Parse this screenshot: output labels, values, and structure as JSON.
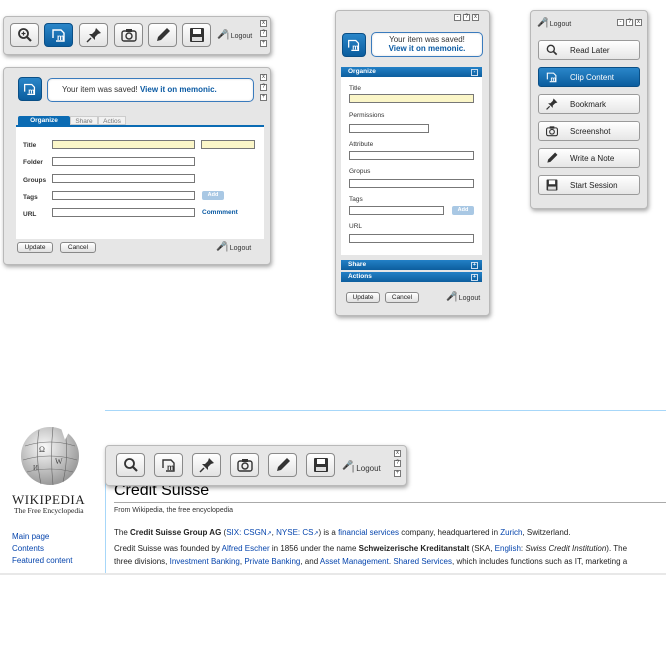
{
  "toolbar_top": {
    "buttons": [
      {
        "icon": "read-later-icon",
        "label": "Read Later"
      },
      {
        "icon": "clip-content-icon",
        "label": "Clip Content"
      },
      {
        "icon": "bookmark-icon",
        "label": "Bookmark"
      },
      {
        "icon": "screenshot-icon",
        "label": "Screenshot"
      },
      {
        "icon": "write-note-icon",
        "label": "Write a Note"
      },
      {
        "icon": "start-session-icon",
        "label": "Start Session"
      }
    ],
    "logout": "| Logout"
  },
  "saved_message": {
    "text": "Your item was saved!",
    "link": "View it on memonic."
  },
  "horizontal_form": {
    "tabs": [
      "Organize",
      "Share",
      "Actios"
    ],
    "fields": {
      "title": "Title",
      "folder": "Folder",
      "groups": "Groups",
      "tags": "Tags",
      "url": "URL"
    },
    "add_label": "Add",
    "comment_link": "Commment",
    "update_label": "Update",
    "cancel_label": "Cancel",
    "logout": "| Logout"
  },
  "vertical_form": {
    "organize_bar": "Organize",
    "fields": {
      "title": "Title",
      "permissions": "Permissions",
      "attribute": "Attribute",
      "groups": "Gropus",
      "tags": "Tags",
      "url": "URL"
    },
    "add_label": "Add",
    "share_bar": "Share",
    "actions_bar": "Actions",
    "update_label": "Update",
    "cancel_label": "Cancel",
    "logout": "| Logout"
  },
  "menu": {
    "logout": "| Logout",
    "items": [
      "Read Later",
      "Clip Content",
      "Bookmark",
      "Screenshot",
      "Write a Note",
      "Start Session"
    ]
  },
  "wikipedia": {
    "wordmark": "WIKIPEDIA",
    "tagline": "The Free Encyclopedia",
    "nav": [
      "Main page",
      "Contents",
      "Featured content"
    ],
    "title": "Credit Suisse",
    "from": "From Wikipedia, the free encyclopedia",
    "p1": {
      "a": "The ",
      "b": "Credit Suisse Group AG",
      "c": " (",
      "d": "SIX: CSGN",
      "e": ", ",
      "f": "NYSE: CS",
      "g": ") is a ",
      "h": "financial services",
      "i": " company, headquartered in ",
      "j": "Zurich",
      "k": ", Switzerland."
    },
    "p2": {
      "a": "Credit Suisse was founded by ",
      "b": "Alfred Escher",
      "c": " in 1856 under the name ",
      "d": "Schweizerische Kreditanstalt",
      "e": " (SKA, ",
      "f": "English",
      "g": ": ",
      "h": "Swiss Credit Institution",
      "i": "). The"
    },
    "p3": {
      "a": "three divisions, ",
      "b": "Investment Banking",
      "c": ", ",
      "d": "Private Banking",
      "e": ", and ",
      "f": "Asset Management",
      "g": ". ",
      "h": "Shared Services",
      "i": ", which includes functions such as IT, marketing a"
    },
    "logout": "| Logout"
  },
  "colors": {
    "accent": "#0b6bb3",
    "field_highlight": "#fbf6c8",
    "link": "#0645ad"
  }
}
